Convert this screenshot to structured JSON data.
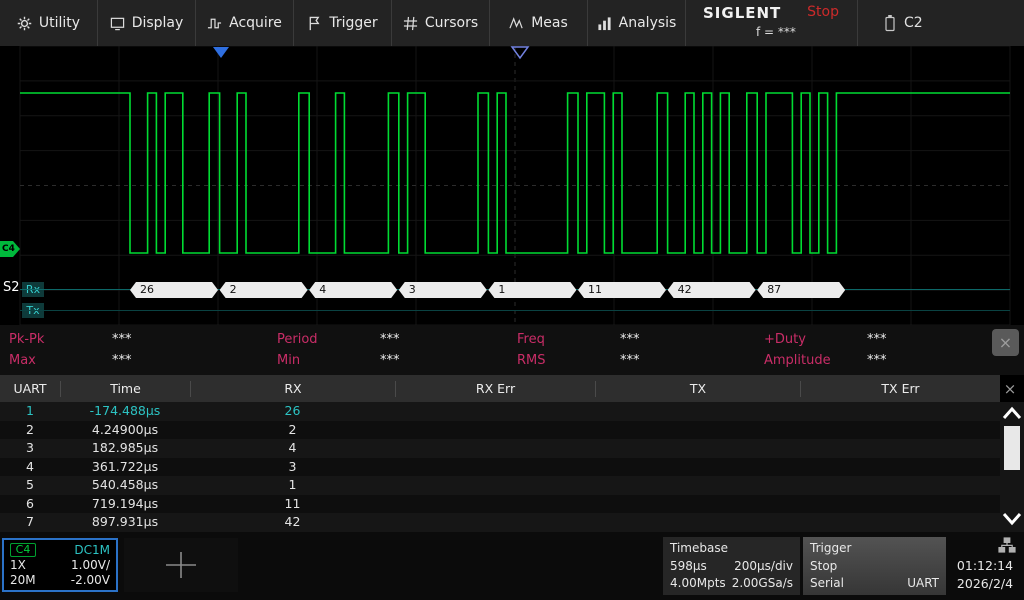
{
  "menu": {
    "items": [
      {
        "label": "Utility",
        "icon": "gear-icon"
      },
      {
        "label": "Display",
        "icon": "display-icon"
      },
      {
        "label": "Acquire",
        "icon": "acquire-icon"
      },
      {
        "label": "Trigger",
        "icon": "flag-icon"
      },
      {
        "label": "Cursors",
        "icon": "cursors-icon"
      },
      {
        "label": "Meas",
        "icon": "meas-icon"
      },
      {
        "label": "Analysis",
        "icon": "analysis-icon"
      }
    ],
    "brand": "SIGLENT",
    "run_state": "Stop",
    "freq_readout": "f = ***",
    "battery_label": "C2"
  },
  "scope": {
    "channel_marker": "C4",
    "decode": {
      "bus_label": "S2",
      "rx_label": "Rx",
      "tx_label": "Tx",
      "rx_bytes": [
        "26",
        "2",
        "4",
        "3",
        "1",
        "11",
        "42",
        "87"
      ]
    },
    "colors": {
      "trace": "#00dc32",
      "trigger_marker": "#2f6fe0",
      "decode_line": "#0d6868",
      "highlight": "#2cc3c3",
      "measurement_label": "#c92d67"
    }
  },
  "measurements": {
    "items": [
      {
        "label": "Pk-Pk",
        "value": "***"
      },
      {
        "label": "Period",
        "value": "***"
      },
      {
        "label": "Freq",
        "value": "***"
      },
      {
        "label": "+Duty",
        "value": "***"
      },
      {
        "label": "Max",
        "value": "***"
      },
      {
        "label": "Min",
        "value": "***"
      },
      {
        "label": "RMS",
        "value": "***"
      },
      {
        "label": "Amplitude",
        "value": "***"
      }
    ],
    "close_label": "×"
  },
  "uart_table": {
    "columns": [
      "UART",
      "Time",
      "RX",
      "RX Err",
      "TX",
      "TX Err"
    ],
    "rows": [
      {
        "n": "1",
        "time": "-174.488µs",
        "rx": "26",
        "rx_err": "",
        "tx": "",
        "tx_err": "",
        "highlight": true
      },
      {
        "n": "2",
        "time": "4.24900µs",
        "rx": "2",
        "rx_err": "",
        "tx": "",
        "tx_err": "",
        "highlight": false
      },
      {
        "n": "3",
        "time": "182.985µs",
        "rx": "4",
        "rx_err": "",
        "tx": "",
        "tx_err": "",
        "highlight": false
      },
      {
        "n": "4",
        "time": "361.722µs",
        "rx": "3",
        "rx_err": "",
        "tx": "",
        "tx_err": "",
        "highlight": false
      },
      {
        "n": "5",
        "time": "540.458µs",
        "rx": "1",
        "rx_err": "",
        "tx": "",
        "tx_err": "",
        "highlight": false
      },
      {
        "n": "6",
        "time": "719.194µs",
        "rx": "11",
        "rx_err": "",
        "tx": "",
        "tx_err": "",
        "highlight": false
      },
      {
        "n": "7",
        "time": "897.931µs",
        "rx": "42",
        "rx_err": "",
        "tx": "",
        "tx_err": "",
        "highlight": false
      }
    ],
    "close_label": "×"
  },
  "bottom": {
    "channel": {
      "name": "C4",
      "coupling": "DC1M",
      "atten": "1X",
      "vscale": "1.00V/",
      "bandwidth": "20M",
      "offset": "-2.00V"
    },
    "timebase": {
      "title": "Timebase",
      "delay": "598µs",
      "scale": "200µs/div",
      "mem": "4.00Mpts",
      "srate": "2.00GSa/s"
    },
    "trigger": {
      "title": "Trigger",
      "status": "Stop",
      "source": "Serial",
      "type": "UART"
    },
    "clock": {
      "time": "01:12:14",
      "date": "2026/2/4"
    }
  }
}
